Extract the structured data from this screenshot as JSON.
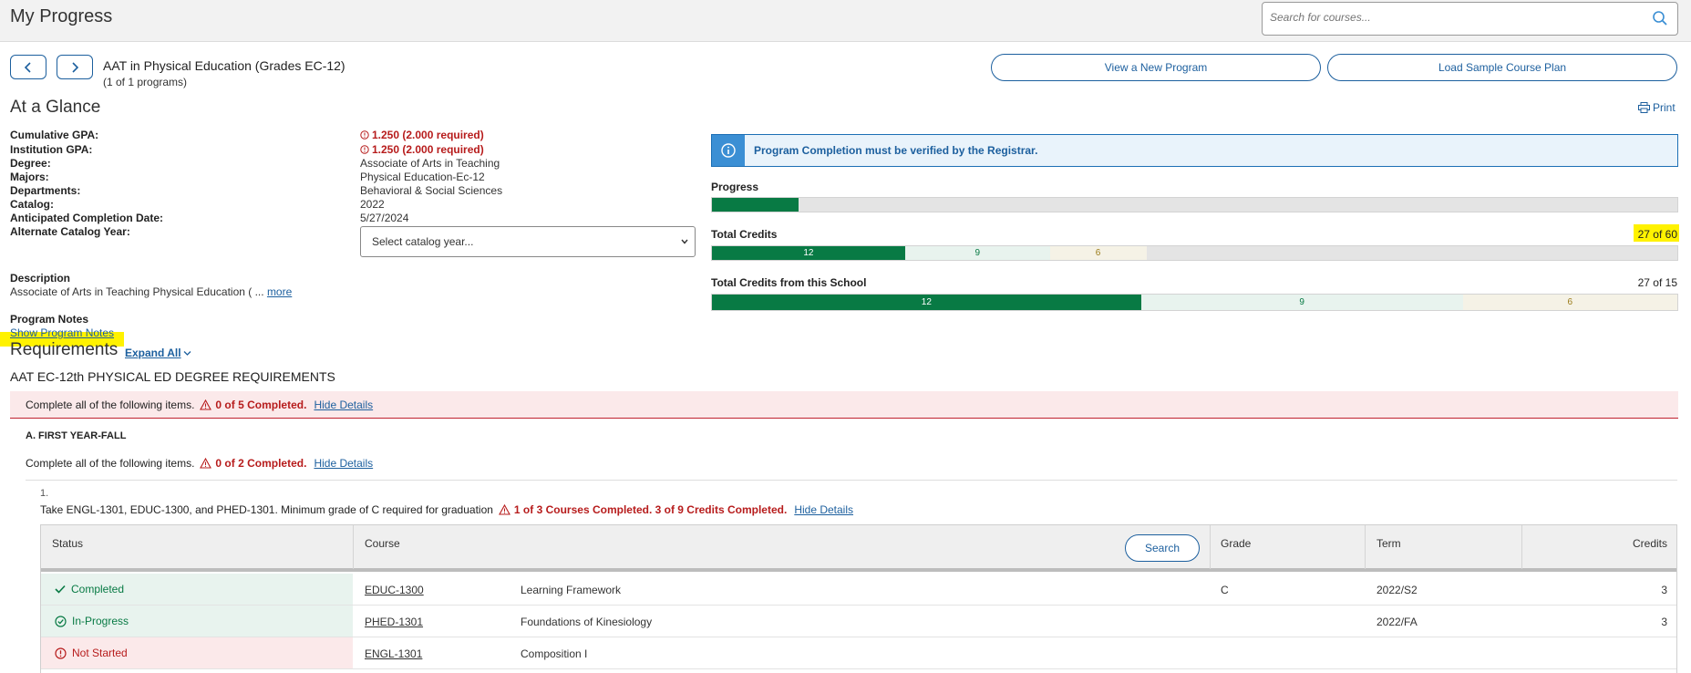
{
  "header": {
    "title": "My Progress",
    "search_placeholder": "Search for courses..."
  },
  "program": {
    "name": "AAT in Physical Education (Grades EC-12)",
    "count": "(1 of 1 programs)",
    "view_new_label": "View a New Program",
    "load_sample_label": "Load Sample Course Plan"
  },
  "glance": {
    "title": "At a Glance",
    "print_label": "Print",
    "fields": {
      "cumulative_gpa_label": "Cumulative GPA:",
      "cumulative_gpa_value": "1.250 (2.000 required)",
      "institution_gpa_label": "Institution GPA:",
      "institution_gpa_value": "1.250 (2.000 required)",
      "degree_label": "Degree:",
      "degree_value": "Associate of Arts in Teaching",
      "majors_label": "Majors:",
      "majors_value": "Physical Education-Ec-12",
      "departments_label": "Departments:",
      "departments_value": "Behavioral & Social Sciences",
      "catalog_label": "Catalog:",
      "catalog_value": "2022",
      "completion_label": "Anticipated Completion Date:",
      "completion_value": "5/27/2024",
      "alt_catalog_label": "Alternate Catalog Year:",
      "alt_catalog_select": "Select catalog year..."
    },
    "description_label": "Description",
    "description_text": "Associate of Arts in Teaching Physical Education ( ...",
    "more_label": "more",
    "notes_label": "Program Notes",
    "show_notes_label": "Show Program Notes"
  },
  "progress_panel": {
    "banner": "Program Completion must be verified by the Registrar.",
    "progress_label": "Progress",
    "progress_fraction": 0.09,
    "total_credits_label": "Total Credits",
    "total_credits_value": "27 of 60",
    "total_credits_max": 60,
    "total_credits_segments": {
      "completed": 12,
      "in_progress": 9,
      "planned": 6
    },
    "school_credits_label": "Total Credits from this School",
    "school_credits_value": "27 of 15",
    "school_credits_max": 27,
    "school_credits_segments": {
      "completed": 12,
      "in_progress": 9,
      "planned": 6
    }
  },
  "requirements": {
    "title": "Requirements",
    "expand_all": "Expand All",
    "heading": "AAT EC-12th PHYSICAL ED DEGREE REQUIREMENTS",
    "top_status_text": "Complete all of the following items.",
    "top_status_warn": "0 of 5 Completed.",
    "hide_details": "Hide Details",
    "group_a_title": "A.  FIRST YEAR-FALL",
    "group_a_text": "Complete all of the following items.",
    "group_a_warn": "0 of 2 Completed.",
    "item_number": "1.",
    "item_text": "Take ENGL-1301, EDUC-1300, and PHED-1301. Minimum grade of C required for graduation",
    "item_warn": "1 of 3 Courses Completed. 3 of 9 Credits Completed."
  },
  "table": {
    "headers": {
      "status": "Status",
      "course": "Course",
      "search": "Search",
      "grade": "Grade",
      "term": "Term",
      "credits": "Credits"
    },
    "rows": [
      {
        "status": "Completed",
        "code": "EDUC-1300",
        "title": "Learning Framework",
        "grade": "C",
        "term": "2022/S2",
        "credits": "3"
      },
      {
        "status": "In-Progress",
        "code": "PHED-1301",
        "title": "Foundations of Kinesiology",
        "grade": "",
        "term": "2022/FA",
        "credits": "3"
      },
      {
        "status": "Not Started",
        "code": "ENGL-1301",
        "title": "Composition I",
        "grade": "",
        "term": "",
        "credits": ""
      }
    ]
  },
  "colors": {
    "accent": "#1c5f9e",
    "completed": "#087a44",
    "warning": "#b71c1c",
    "highlight": "#fff200"
  }
}
